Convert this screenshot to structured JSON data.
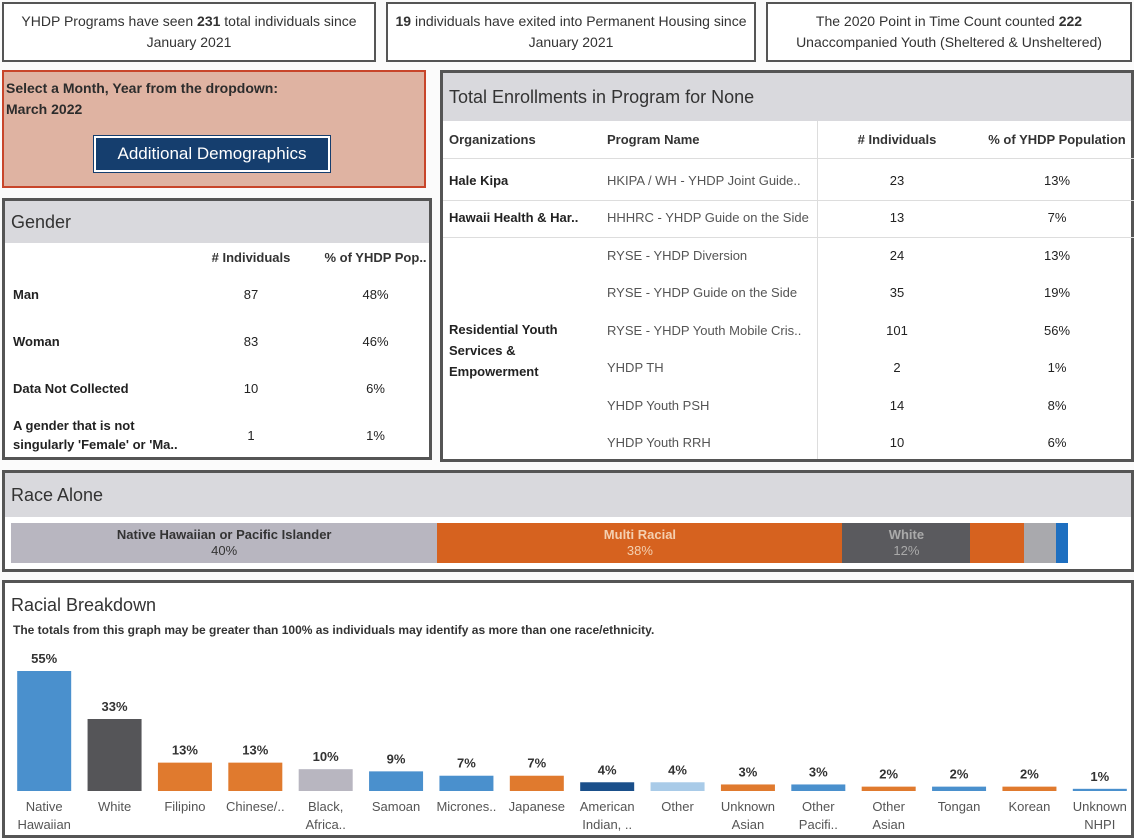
{
  "kpis": [
    {
      "pre": "YHDP Programs have seen ",
      "num": "231",
      "post": " total individuals since January 2021"
    },
    {
      "pre": "",
      "num": "19",
      "post": " individuals have exited into Permanent Housing since January 2021"
    },
    {
      "pre": "The 2020 Point in Time Count counted ",
      "num": "222",
      "post": " Unaccompanied Youth (Sheltered & Unsheltered)"
    }
  ],
  "selector": {
    "label": "Select a Month, Year from the dropdown:",
    "value": "March 2022",
    "button": "Additional Demographics"
  },
  "gender": {
    "title": "Gender",
    "headers": [
      "# Individuals",
      "% of YHDP Pop.."
    ],
    "rows": [
      {
        "label": "Man",
        "n": "87",
        "pct": "48%"
      },
      {
        "label": "Woman",
        "n": "83",
        "pct": "46%"
      },
      {
        "label": "Data Not Collected",
        "n": "10",
        "pct": "6%"
      },
      {
        "label": "A gender that is not singularly 'Female' or 'Ma..",
        "n": "1",
        "pct": "1%"
      }
    ]
  },
  "enrollments": {
    "title": "Total Enrollments in Program for None",
    "headers": [
      "Organizations",
      "Program Name",
      "# Individuals",
      "% of YHDP Population"
    ],
    "rows": [
      {
        "org": "Hale Kipa",
        "program": "HKIPA / WH - YHDP Joint Guide..",
        "n": "23",
        "pct": "13%"
      },
      {
        "org": "Hawaii Health & Har..",
        "program": "HHHRC - YHDP Guide on the Side",
        "n": "13",
        "pct": "7%"
      },
      {
        "org": "",
        "program": "RYSE - YHDP Diversion",
        "n": "24",
        "pct": "13%"
      },
      {
        "org": "",
        "program": "RYSE - YHDP Guide on the Side",
        "n": "35",
        "pct": "19%"
      },
      {
        "org": "",
        "program": "RYSE - YHDP Youth Mobile Cris..",
        "n": "101",
        "pct": "56%"
      },
      {
        "org": "",
        "program": "YHDP TH",
        "n": "2",
        "pct": "1%"
      },
      {
        "org": "",
        "program": "YHDP Youth PSH",
        "n": "14",
        "pct": "8%"
      },
      {
        "org": "",
        "program": "YHDP Youth RRH",
        "n": "10",
        "pct": "6%"
      }
    ],
    "merged_org": "Residential Youth Services & Empowerment"
  },
  "race_alone": {
    "title": "Race Alone",
    "segments": [
      {
        "name": "Native Hawaiian or Pacific Islander",
        "pct": "40%",
        "value": 40,
        "color": "#b8b6c0",
        "text": "#333"
      },
      {
        "name": "Multi Racial",
        "pct": "38%",
        "value": 38,
        "color": "#d6621f",
        "text": "#f4d0b0"
      },
      {
        "name": "White",
        "pct": "12%",
        "value": 12,
        "color": "#5a5a5e",
        "text": "#aaa"
      },
      {
        "name": "",
        "pct": "",
        "value": 5,
        "color": "#d6621f",
        "text": "#fff"
      },
      {
        "name": "",
        "pct": "",
        "value": 3,
        "color": "#a9a9ad",
        "text": "#fff"
      },
      {
        "name": "",
        "pct": "",
        "value": 1.2,
        "color": "#1e6fc0",
        "text": "#fff"
      }
    ]
  },
  "breakdown": {
    "title": "Racial Breakdown",
    "subtitle": "The totals from this graph may be greater than 100% as individuals may identify as more than one race/ethnicity."
  },
  "chart_data": {
    "type": "bar",
    "categories": [
      "Native Hawaiian",
      "White",
      "Filipino",
      "Chinese/..",
      "Black, Africa..",
      "Samoan",
      "Micrones..",
      "Japanese",
      "American Indian, ..",
      "Other",
      "Unknown Asian",
      "Other Pacifi..",
      "Other Asian",
      "Tongan",
      "Korean",
      "Unknown NHPI"
    ],
    "values": [
      55,
      33,
      13,
      13,
      10,
      9,
      7,
      7,
      4,
      4,
      3,
      3,
      2,
      2,
      2,
      1
    ],
    "labels": [
      "55%",
      "33%",
      "13%",
      "13%",
      "10%",
      "9%",
      "7%",
      "7%",
      "4%",
      "4%",
      "3%",
      "3%",
      "2%",
      "2%",
      "2%",
      "1%"
    ],
    "colors": [
      "#4a90cd",
      "#555558",
      "#e07a2e",
      "#e07a2e",
      "#b8b6c0",
      "#4a90cd",
      "#4a90cd",
      "#e07a2e",
      "#1a4f8a",
      "#a9cbe8",
      "#e07a2e",
      "#4a90cd",
      "#e07a2e",
      "#4a90cd",
      "#e07a2e",
      "#4a90cd"
    ],
    "ylim": [
      0,
      55
    ],
    "grid": false
  }
}
